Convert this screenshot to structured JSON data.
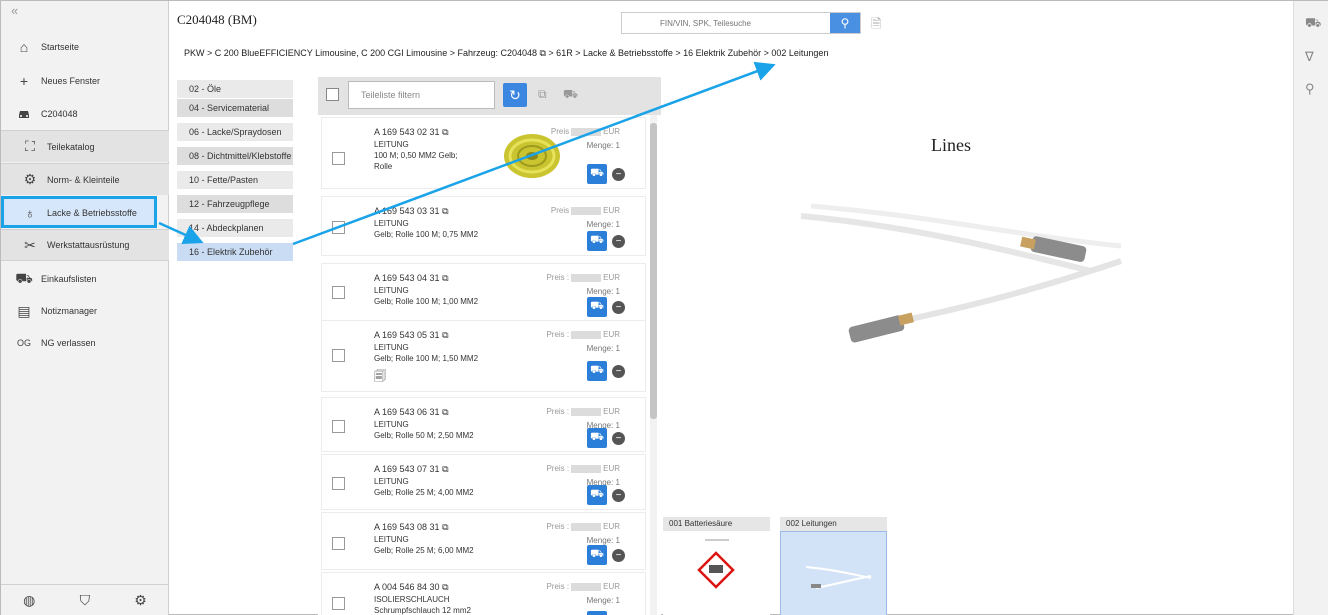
{
  "sidebar": {
    "collapse_icon": "«",
    "items": [
      {
        "label": "Startseite",
        "icon": "home-icon"
      },
      {
        "label": "Neues Fenster",
        "icon": "plus-icon"
      },
      {
        "label": "C204048",
        "icon": "car-icon"
      },
      {
        "label": "Teilekatalog",
        "icon": "catalog-icon"
      },
      {
        "label": "Norm- & Kleinteile",
        "icon": "screws-icon"
      },
      {
        "label": "Lacke & Betriebsstoffe",
        "icon": "paint-icon"
      },
      {
        "label": "Werkstattausrüstung",
        "icon": "tools-icon"
      },
      {
        "label": "Einkaufslisten",
        "icon": "cart-icon"
      },
      {
        "label": "Notizmanager",
        "icon": "note-icon"
      },
      {
        "label": "NG verlassen",
        "prefix": "OG"
      }
    ]
  },
  "header": {
    "title": "C204048 (BM)",
    "search_placeholder": "FIN/VIN, SPK, Teilesuche",
    "breadcrumb": "PKW > C 200 BlueEFFICIENCY Limousine, C 200 CGI Limousine > Fahrzeug: C204048 ⧉ > 61R > Lacke & Betriebsstoffe > 16 Elektrik Zubehör > 002 Leitungen"
  },
  "categories": [
    "02 - Öle",
    "04 - Servicematerial",
    "06 - Lacke/Spraydosen",
    "08 - Dichtmittel/Klebstoffe",
    "10 - Fette/Pasten",
    "12 - Fahrzeugpflege",
    "14 - Abdeckplanen",
    "16 - Elektrik Zubehör"
  ],
  "filter": {
    "placeholder": "Teileliste filtern"
  },
  "parts": [
    {
      "number": "A 169 543 02 31",
      "name": "LEITUNG",
      "desc": "100 M; 0,50 MM2 Gelb;",
      "desc2": "Rolle",
      "preis": "Preis",
      "currency": "EUR",
      "menge": "Menge: 1"
    },
    {
      "number": "A 169 543 03 31",
      "name": "LEITUNG",
      "desc": "Gelb; Rolle 100 M; 0,75 MM2",
      "desc2": "",
      "preis": "Preis",
      "currency": "EUR",
      "menge": "Menge: 1"
    },
    {
      "number": "A 169 543 04 31",
      "name": "LEITUNG",
      "desc": "Gelb; Rolle 100 M; 1,00 MM2",
      "desc2": "",
      "preis": "Preis :",
      "currency": "EUR",
      "menge": "Menge: 1"
    },
    {
      "number": "A 169 543 05 31",
      "name": "LEITUNG",
      "desc": "Gelb; Rolle 100 M; 1,50 MM2",
      "desc2": "",
      "preis": "Preis :",
      "currency": "EUR",
      "menge": "Menge: 1"
    },
    {
      "number": "A 169 543 06 31",
      "name": "LEITUNG",
      "desc": "Gelb; Rolle 50 M; 2,50 MM2",
      "desc2": "",
      "preis": "Preis :",
      "currency": "EUR",
      "menge": "Menge: 1"
    },
    {
      "number": "A 169 543 07 31",
      "name": "LEITUNG",
      "desc": "Gelb; Rolle 25 M; 4,00 MM2",
      "desc2": "",
      "preis": "Preis :",
      "currency": "EUR",
      "menge": "Menge: 1"
    },
    {
      "number": "A 169 543 08 31",
      "name": "LEITUNG",
      "desc": "Gelb; Rolle 25 M; 6,00 MM2",
      "desc2": "",
      "preis": "Preis :",
      "currency": "EUR",
      "menge": "Menge: 1"
    },
    {
      "number": "A 004 546 84 30",
      "name": "ISOLIERSCHLAUCH",
      "desc": "Schrumpfschlauch 12 mm2",
      "desc2": "",
      "preis": "Preis :",
      "currency": "EUR",
      "menge": "Menge: 1"
    }
  ],
  "image_panel": {
    "title": "Lines",
    "thumbnails": [
      {
        "label": "001 Batteriesäure"
      },
      {
        "label": "002 Leitungen"
      }
    ]
  },
  "colors": {
    "accent": "#1aa3e8",
    "button": "#2c7fd9"
  }
}
